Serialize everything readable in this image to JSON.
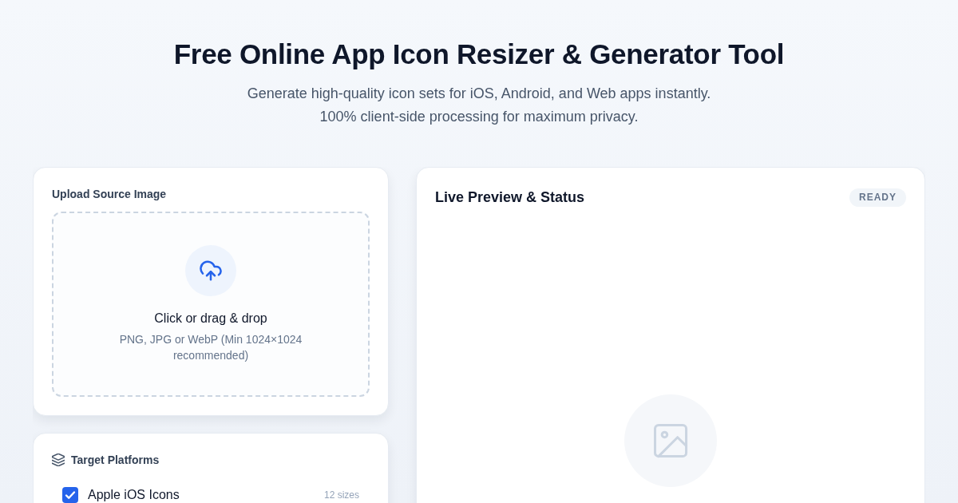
{
  "header": {
    "title": "Free Online App Icon Resizer & Generator Tool",
    "subtitle_lines": [
      "Generate high-quality icon sets for iOS, Android, and Web apps instantly.",
      "100% client-side processing for maximum privacy."
    ]
  },
  "upload": {
    "label": "Upload Source Image",
    "dropzone": {
      "title": "Click or drag & drop",
      "hint": "PNG, JPG or WebP (Min 1024×1024 recommended)"
    }
  },
  "platforms": {
    "title": "Target Platforms",
    "items": [
      {
        "label": "Apple iOS Icons",
        "count": "12 sizes",
        "checked": true
      }
    ]
  },
  "preview": {
    "title": "Live Preview & Status",
    "status": "READY"
  }
}
